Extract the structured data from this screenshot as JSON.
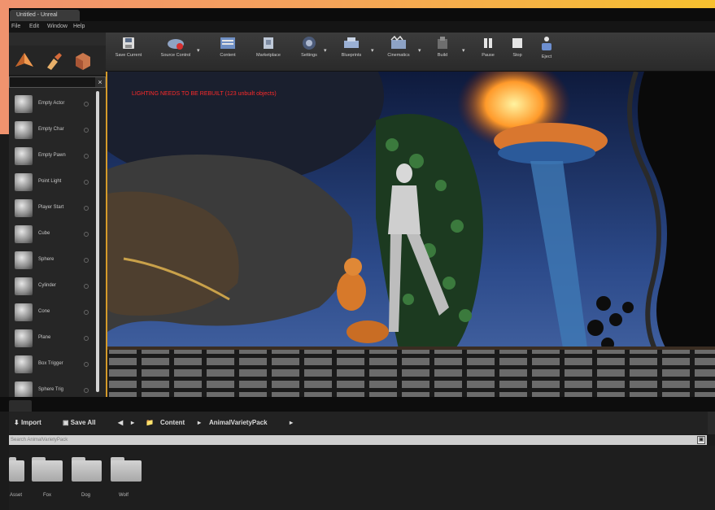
{
  "window": {
    "doc_tab": "Untitled - Unreal",
    "menu": [
      "File",
      "Edit",
      "Window",
      "Help"
    ]
  },
  "toolbar": {
    "buttons": [
      {
        "label": "Save Current",
        "icon": "save-icon"
      },
      {
        "label": "Source Control",
        "icon": "source-control-icon"
      },
      {
        "label": "Content",
        "icon": "content-icon"
      },
      {
        "label": "Marketplace",
        "icon": "marketplace-icon"
      },
      {
        "label": "Settings",
        "icon": "settings-icon"
      },
      {
        "label": "Blueprints",
        "icon": "blueprints-icon"
      },
      {
        "label": "Cinematics",
        "icon": "cinematics-icon"
      },
      {
        "label": "Build",
        "icon": "build-icon"
      },
      {
        "label": "Pause",
        "icon": "pause-icon"
      },
      {
        "label": "Stop",
        "icon": "stop-icon"
      },
      {
        "label": "Eject",
        "icon": "eject-icon"
      }
    ]
  },
  "modes": {
    "icons": [
      "place-mode-icon",
      "paint-mode-icon",
      "landscape-mode-icon"
    ]
  },
  "place_panel": {
    "items": [
      {
        "label": "Empty Actor",
        "icon": "empty-actor-icon"
      },
      {
        "label": "Empty Char",
        "icon": "empty-character-icon"
      },
      {
        "label": "Empty Pawn",
        "icon": "empty-pawn-icon"
      },
      {
        "label": "Point Light",
        "icon": "point-light-icon"
      },
      {
        "label": "Player Start",
        "icon": "player-start-icon"
      },
      {
        "label": "Cube",
        "icon": "cube-icon"
      },
      {
        "label": "Sphere",
        "icon": "sphere-icon"
      },
      {
        "label": "Cylinder",
        "icon": "cylinder-icon"
      },
      {
        "label": "Cone",
        "icon": "cone-icon"
      },
      {
        "label": "Plane",
        "icon": "plane-icon"
      },
      {
        "label": "Box Trigger",
        "icon": "box-trigger-icon"
      },
      {
        "label": "Sphere Trig",
        "icon": "sphere-trigger-icon"
      }
    ]
  },
  "viewport": {
    "warning": "LIGHTING NEEDS TO BE REBUILT (123 unbuilt objects)"
  },
  "content_browser": {
    "import_label": "Import",
    "save_all_label": "Save All",
    "nav_back": "◀",
    "nav_forward": "▸",
    "content_label": "Content",
    "pack_label": "AnimalVarietyPack",
    "path_placeholder": "Search AnimalVarietyPack",
    "folders": [
      "Asset",
      "Fox",
      "Dog",
      "Wolf"
    ]
  }
}
